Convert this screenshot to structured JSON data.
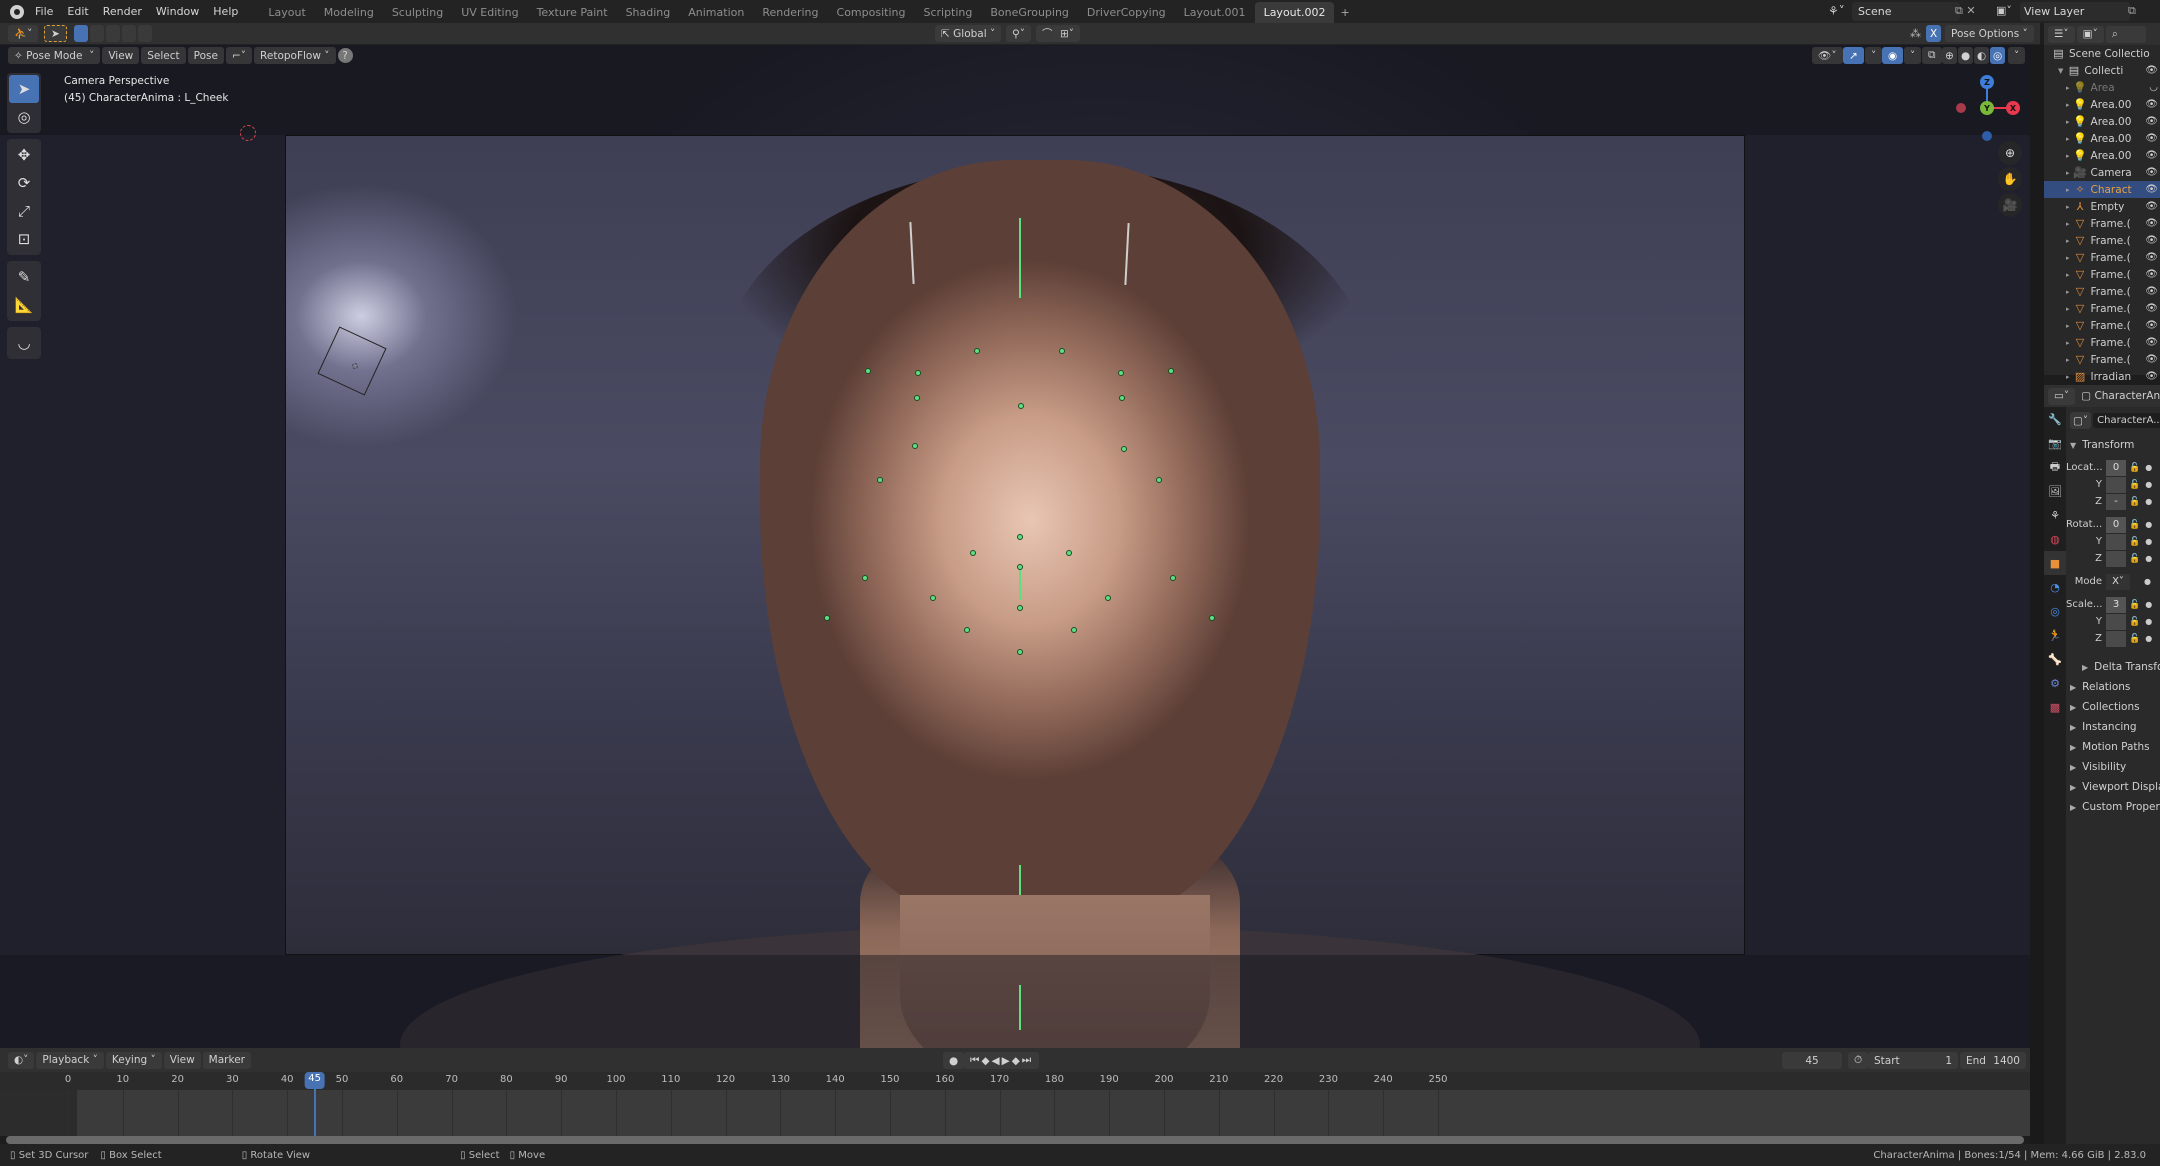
{
  "topbar": {
    "menus": [
      "File",
      "Edit",
      "Render",
      "Window",
      "Help"
    ],
    "workspaces": [
      "Layout",
      "Modeling",
      "Sculpting",
      "UV Editing",
      "Texture Paint",
      "Shading",
      "Animation",
      "Rendering",
      "Compositing",
      "Scripting",
      "BoneGrouping",
      "DriverCopying",
      "Layout.001",
      "Layout.002"
    ],
    "active_workspace": "Layout.002",
    "add_workspace": "+",
    "scene_label": "Scene",
    "view_layer_label": "View Layer"
  },
  "tool_header": {
    "orientation": "Global",
    "mirror_x": "X",
    "pose_options": "Pose Options"
  },
  "viewport_header": {
    "mode": "Pose Mode",
    "menus": [
      "View",
      "Select",
      "Pose"
    ],
    "addon": "RetopoFlow",
    "help": "?"
  },
  "viewport": {
    "view_name": "Camera Perspective",
    "object_info": "(45) CharacterAnima : L_Cheek",
    "gizmo_axes": {
      "z": "Z",
      "y": "Y",
      "x": "X"
    },
    "colors": {
      "bone_green": "#5ee07f",
      "axis_x": "#e8384e",
      "axis_y": "#7ab83a",
      "axis_z": "#3e7ed8",
      "active_blue": "#4772b3"
    }
  },
  "toolbar": {
    "tools": [
      "select-box",
      "cursor",
      "move",
      "rotate",
      "scale",
      "transform",
      "annotate",
      "measure",
      "bend"
    ]
  },
  "outliner": {
    "root": "Scene Collectio",
    "items": [
      {
        "label": "Collecti",
        "icon": "collection",
        "eye": "visible"
      },
      {
        "label": "Area",
        "icon": "light",
        "eye": "hidden"
      },
      {
        "label": "Area.00",
        "icon": "light",
        "eye": "visible"
      },
      {
        "label": "Area.00",
        "icon": "light",
        "eye": "visible"
      },
      {
        "label": "Area.00",
        "icon": "light",
        "eye": "visible"
      },
      {
        "label": "Area.00",
        "icon": "light",
        "eye": "visible"
      },
      {
        "label": "Camera",
        "icon": "camera",
        "eye": "visible"
      },
      {
        "label": "Charact",
        "icon": "armature",
        "eye": "visible",
        "selected": true
      },
      {
        "label": "Empty",
        "icon": "empty",
        "eye": "visible"
      },
      {
        "label": "Frame.(",
        "icon": "mesh",
        "eye": "visible"
      },
      {
        "label": "Frame.(",
        "icon": "mesh",
        "eye": "visible"
      },
      {
        "label": "Frame.(",
        "icon": "mesh",
        "eye": "visible"
      },
      {
        "label": "Frame.(",
        "icon": "mesh",
        "eye": "visible"
      },
      {
        "label": "Frame.(",
        "icon": "mesh",
        "eye": "visible"
      },
      {
        "label": "Frame.(",
        "icon": "mesh",
        "eye": "visible"
      },
      {
        "label": "Frame.(",
        "icon": "mesh",
        "eye": "visible"
      },
      {
        "label": "Frame.(",
        "icon": "mesh",
        "eye": "visible"
      },
      {
        "label": "Frame.(",
        "icon": "mesh",
        "eye": "visible"
      },
      {
        "label": "Irradian",
        "icon": "probe",
        "eye": "visible"
      }
    ]
  },
  "properties": {
    "header_object": "CharacterAnim",
    "datablock": "CharacterA...",
    "transform_title": "Transform",
    "location_label": "Locat...",
    "location": [
      "0",
      "",
      ""
    ],
    "location_z_value": "-",
    "rotation_label": "Rotat...",
    "rotation": [
      "0",
      "",
      ""
    ],
    "mode_label": "Mode",
    "mode_value": "X",
    "scale_label": "Scale...",
    "scale": [
      "3",
      "",
      ""
    ],
    "axis_y": "Y",
    "axis_z": "Z",
    "delta_transform": "Delta Transform",
    "panels": [
      "Relations",
      "Collections",
      "Instancing",
      "Motion Paths",
      "Visibility",
      "Viewport Display",
      "Custom Propertie"
    ]
  },
  "timeline": {
    "menus": [
      "Playback",
      "Keying",
      "View",
      "Marker"
    ],
    "current_frame": "45",
    "start_label": "Start",
    "start": "1",
    "end_label": "End",
    "end": "1400",
    "ticks": [
      "0",
      "10",
      "20",
      "30",
      "40",
      "50",
      "60",
      "70",
      "80",
      "90",
      "100",
      "110",
      "120",
      "130",
      "140",
      "150",
      "160",
      "170",
      "180",
      "190",
      "200",
      "210",
      "220",
      "230",
      "240",
      "250"
    ]
  },
  "statusbar": {
    "hints": [
      "Set 3D Cursor",
      "Box Select",
      "Rotate View",
      "Select",
      "Move"
    ],
    "info": "CharacterAnima | Bones:1/54  | Mem: 4.66 GiB | 2.83.0"
  }
}
